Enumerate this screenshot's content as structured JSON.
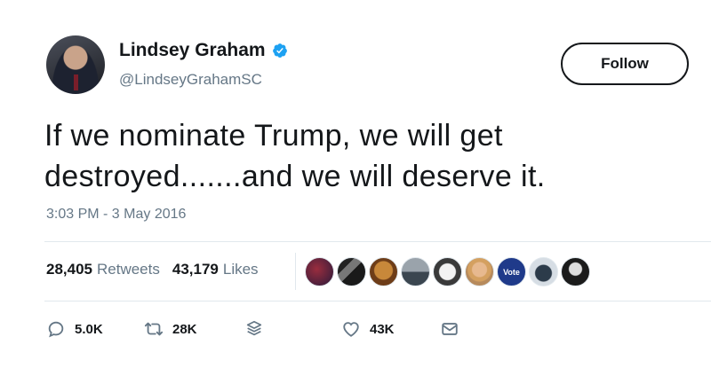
{
  "user": {
    "name": "Lindsey Graham",
    "handle": "@LindseyGrahamSC",
    "verified": true
  },
  "follow_label": "Follow",
  "tweet": {
    "line1": "If we nominate Trump, we will get",
    "line2": "destroyed.......and we will deserve it."
  },
  "timestamp": "3:03 PM - 3 May 2016",
  "stats": {
    "retweets_count": "28,405",
    "retweets_label": "Retweets",
    "likes_count": "43,179",
    "likes_label": "Likes"
  },
  "likers": [
    "liker-avatar-1",
    "liker-avatar-2",
    "liker-avatar-3",
    "liker-avatar-4",
    "liker-avatar-5",
    "liker-avatar-6",
    "liker-avatar-7",
    "liker-avatar-8",
    "liker-avatar-9"
  ],
  "actions": {
    "reply_count": "5.0K",
    "retweet_count": "28K",
    "like_count": "43K"
  },
  "colors": {
    "text": "#14171a",
    "secondary": "#657786",
    "verified": "#1da1f2",
    "divider": "#e1e8ed"
  },
  "liker_badge_text": "Vote"
}
